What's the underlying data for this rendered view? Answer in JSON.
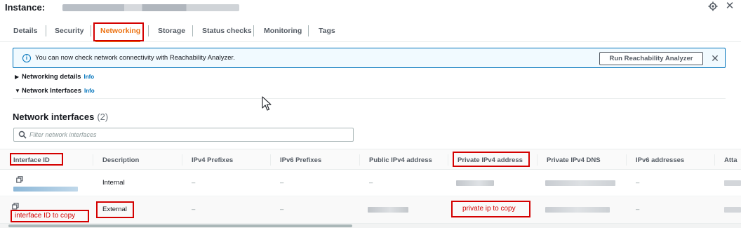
{
  "header": {
    "instance_label": "Instance:",
    "settings_icon": "gear-icon",
    "close_icon": "close-icon"
  },
  "tabs": [
    {
      "label": "Details"
    },
    {
      "label": "Security"
    },
    {
      "label": "Networking",
      "active": true
    },
    {
      "label": "Storage"
    },
    {
      "label": "Status checks"
    },
    {
      "label": "Monitoring"
    },
    {
      "label": "Tags"
    }
  ],
  "banner": {
    "text": "You can now check network connectivity with Reachability Analyzer.",
    "button_label": "Run Reachability Analyzer",
    "icon": "info-icon"
  },
  "expanders": {
    "networking_details": {
      "label": "Networking details",
      "info": "Info",
      "expanded": false
    },
    "network_interfaces": {
      "label": "Network Interfaces",
      "info": "Info",
      "expanded": true
    }
  },
  "section": {
    "title": "Network interfaces",
    "count": "(2)"
  },
  "search": {
    "placeholder": "Filter network interfaces",
    "value": ""
  },
  "table": {
    "columns": [
      "Interface ID",
      "Description",
      "IPv4 Prefixes",
      "IPv6 Prefixes",
      "Public IPv4 address",
      "Private IPv4 address",
      "Private IPv4 DNS",
      "IPv6 addresses",
      "Atta"
    ],
    "rows": [
      {
        "description": "Internal",
        "ipv4_prefixes": "–",
        "ipv6_prefixes": "–",
        "public_ipv4": "–",
        "ipv6_addresses": "–"
      },
      {
        "description": "External",
        "ipv4_prefixes": "–",
        "ipv6_prefixes": "–",
        "ipv6_addresses": "–"
      }
    ]
  },
  "annotations": {
    "interface_id_note": "interface ID to copy",
    "private_ip_note": "private ip to copy"
  },
  "colors": {
    "accent": "#ec7211",
    "link": "#0073bb",
    "annotation": "#d40000"
  }
}
